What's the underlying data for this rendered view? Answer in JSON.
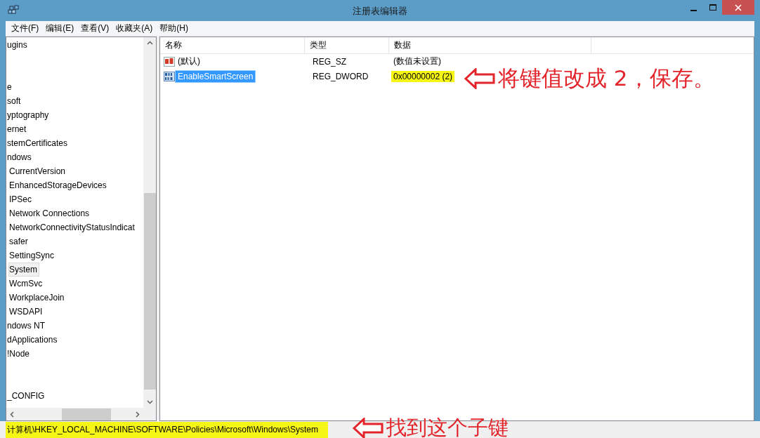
{
  "window": {
    "title": "注册表编辑器"
  },
  "menu": [
    "文件(F)",
    "编辑(E)",
    "查看(V)",
    "收藏夹(A)",
    "帮助(H)"
  ],
  "tree": [
    {
      "kind": "key",
      "label": "ugins",
      "selected": false
    },
    {
      "kind": "blank"
    },
    {
      "kind": "blank"
    },
    {
      "kind": "key",
      "label": "e",
      "selected": false
    },
    {
      "kind": "key",
      "label": "soft",
      "selected": false
    },
    {
      "kind": "key",
      "label": "yptography",
      "selected": false
    },
    {
      "kind": "key",
      "label": "ernet",
      "selected": false
    },
    {
      "kind": "key",
      "label": "stemCertificates",
      "selected": false
    },
    {
      "kind": "key",
      "label": "ndows",
      "selected": false,
      "children": [
        {
          "kind": "key",
          "label": "CurrentVersion",
          "selected": false
        },
        {
          "kind": "key",
          "label": "EnhancedStorageDevices",
          "selected": false
        },
        {
          "kind": "key",
          "label": "IPSec",
          "selected": false
        },
        {
          "kind": "key",
          "label": "Network Connections",
          "selected": false
        },
        {
          "kind": "key",
          "label": "NetworkConnectivityStatusIndicat",
          "selected": false
        },
        {
          "kind": "key",
          "label": "safer",
          "selected": false
        },
        {
          "kind": "key",
          "label": "SettingSync",
          "selected": false
        },
        {
          "kind": "key",
          "label": "System",
          "selected": true
        },
        {
          "kind": "key",
          "label": "WcmSvc",
          "selected": false
        },
        {
          "kind": "key",
          "label": "WorkplaceJoin",
          "selected": false
        },
        {
          "kind": "key",
          "label": "WSDAPI",
          "selected": false
        }
      ]
    },
    {
      "kind": "key",
      "label": "ndows NT",
      "selected": false
    },
    {
      "kind": "key",
      "label": "dApplications",
      "selected": false
    },
    {
      "kind": "key",
      "label": "!Node",
      "selected": false
    },
    {
      "kind": "blank"
    },
    {
      "kind": "blank"
    },
    {
      "kind": "key",
      "label": "_CONFIG",
      "selected": false
    }
  ],
  "table": {
    "columns": [
      "名称",
      "类型",
      "数据"
    ],
    "rows": [
      {
        "kind": "string",
        "name": "(默认)",
        "type": "REG_SZ",
        "data": "(数值未设置)",
        "selected": false,
        "highlighted": false
      },
      {
        "kind": "binary",
        "name": "EnableSmartScreen",
        "type": "REG_DWORD",
        "data": "0x00000002 (2)",
        "selected": true,
        "highlighted": true
      }
    ]
  },
  "annotations": [
    {
      "text": "将键值改成 2，保存。"
    },
    {
      "text": "找到这个子键"
    }
  ],
  "status_bar": {
    "path": "计算机\\HKEY_LOCAL_MACHINE\\SOFTWARE\\Policies\\Microsoft\\Windows\\System",
    "highlighted": true
  }
}
